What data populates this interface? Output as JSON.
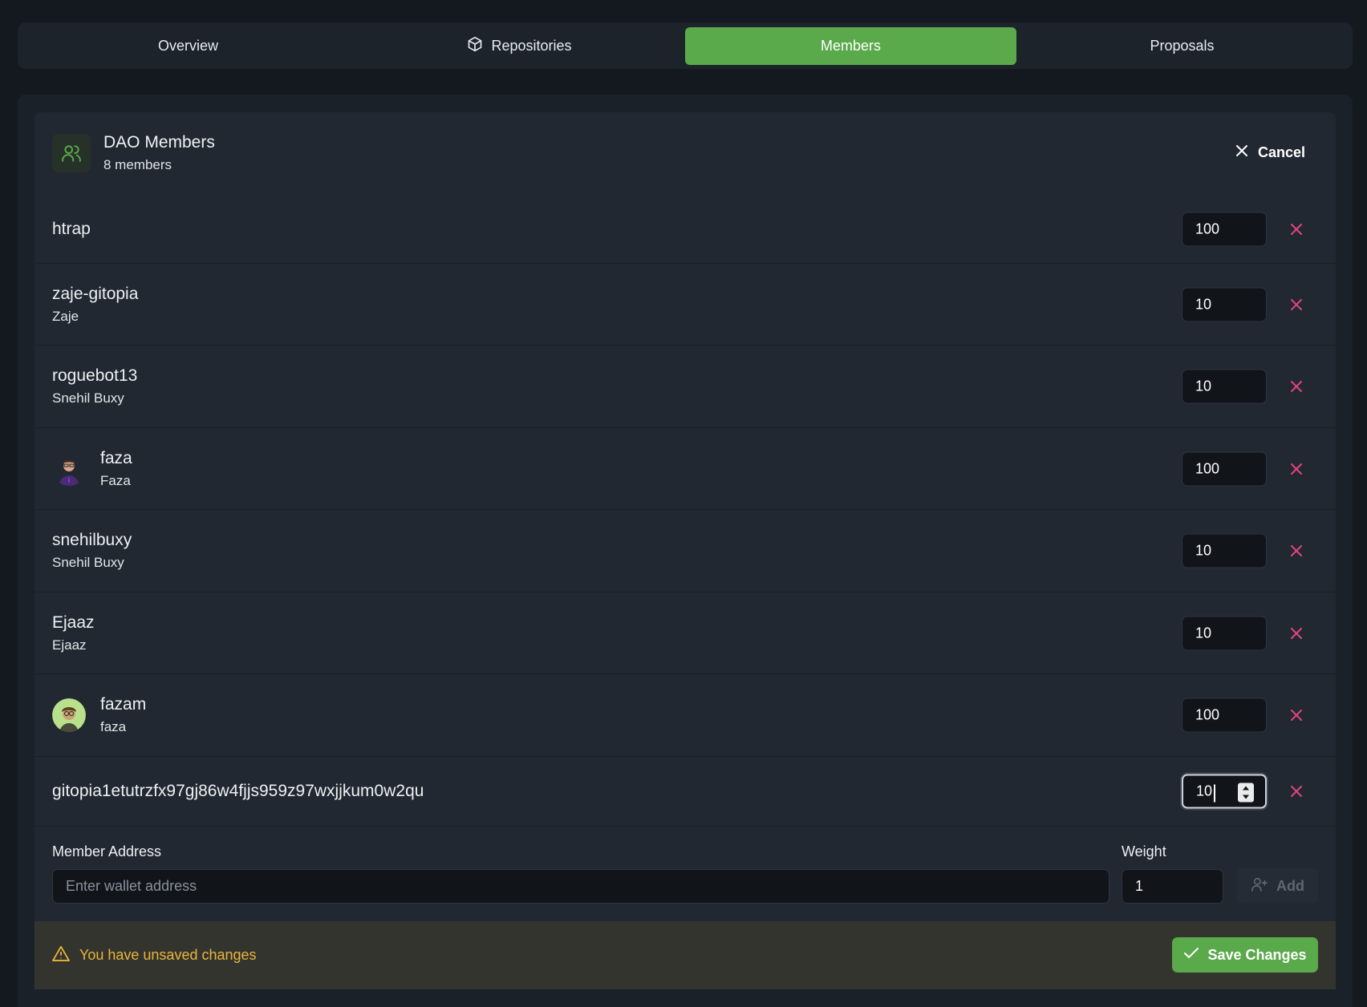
{
  "tabs": [
    {
      "label": "Overview",
      "icon": null
    },
    {
      "label": "Repositories",
      "icon": "cube-icon"
    },
    {
      "label": "Members",
      "icon": null,
      "active": true
    },
    {
      "label": "Proposals",
      "icon": null
    }
  ],
  "header": {
    "title": "DAO Members",
    "subtitle": "8 members",
    "cancel_label": "Cancel",
    "icon": "users-icon"
  },
  "members": [
    {
      "username": "htrap",
      "display": "",
      "weight": "100",
      "avatar": null
    },
    {
      "username": "zaje-gitopia",
      "display": "Zaje",
      "weight": "10",
      "avatar": null
    },
    {
      "username": "roguebot13",
      "display": "Snehil Buxy",
      "weight": "10",
      "avatar": null
    },
    {
      "username": "faza",
      "display": "Faza",
      "weight": "100",
      "avatar": "faza-avatar"
    },
    {
      "username": "snehilbuxy",
      "display": "Snehil Buxy",
      "weight": "10",
      "avatar": null
    },
    {
      "username": "Ejaaz",
      "display": "Ejaaz",
      "weight": "10",
      "avatar": null
    },
    {
      "username": "fazam",
      "display": "faza",
      "weight": "100",
      "avatar": "fazam-avatar"
    },
    {
      "username": "gitopia1etutrzfx97gj86w4fjjs959z97wxjjkum0w2qu",
      "display": "",
      "weight": "10",
      "avatar": null,
      "focused": true
    }
  ],
  "add_form": {
    "address_label": "Member Address",
    "address_placeholder": "Enter wallet address",
    "weight_label": "Weight",
    "weight_value": "1",
    "add_label": "Add"
  },
  "footer": {
    "warning": "You have unsaved changes",
    "save_label": "Save Changes"
  },
  "colors": {
    "accent": "#5aa94a",
    "remove": "#e0457d",
    "warning": "#e9b53a"
  }
}
